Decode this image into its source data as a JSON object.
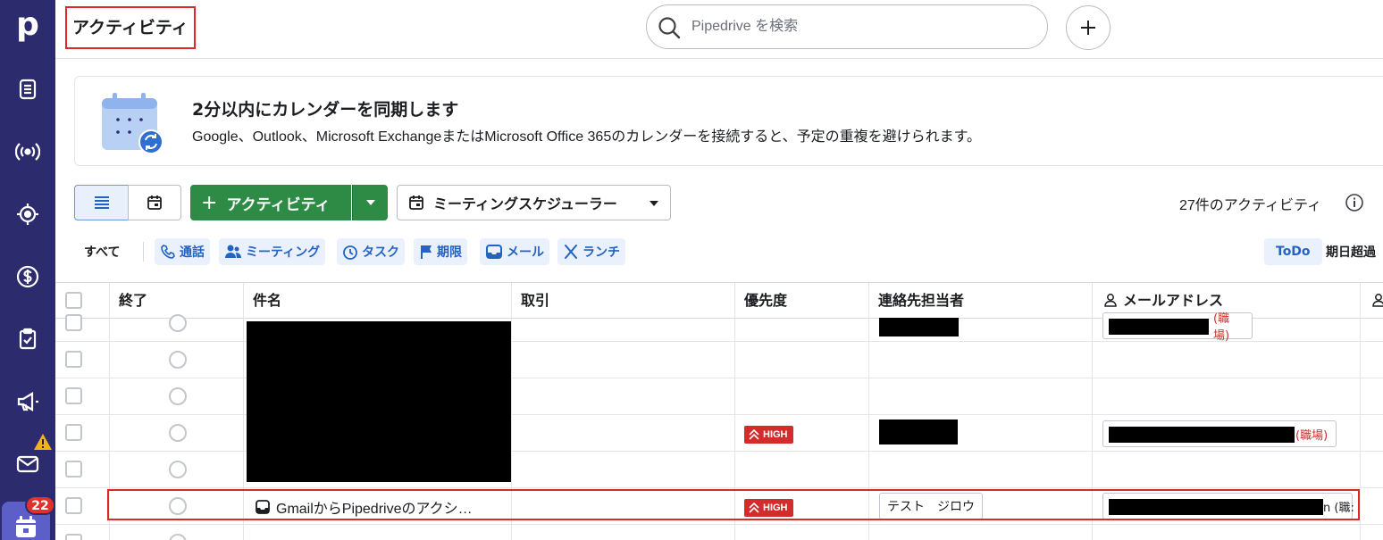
{
  "app": {
    "logo_letter": "p",
    "page_title": "アクティビティ",
    "activities_badge": "22"
  },
  "search": {
    "placeholder": "Pipedrive を検索"
  },
  "banner": {
    "title": "2分以内にカレンダーを同期します",
    "text": "Google、Outlook、Microsoft ExchangeまたはMicrosoft Office 365のカレンダーを接続すると、予定の重複を避けられます。"
  },
  "toolbar": {
    "add_label": "アクティビティ",
    "scheduler_label": "ミーティングスケジューラー",
    "count_text": "27件のアクティビティ"
  },
  "filters": {
    "all": "すべて",
    "types": [
      {
        "label": "通話",
        "icon": "phone-icon"
      },
      {
        "label": "ミーティング",
        "icon": "people-icon"
      },
      {
        "label": "タスク",
        "icon": "clock-icon"
      },
      {
        "label": "期限",
        "icon": "flag-icon"
      },
      {
        "label": "メール",
        "icon": "inbox-icon"
      },
      {
        "label": "ランチ",
        "icon": "utensils-icon"
      }
    ],
    "todo": "ToDo",
    "overdue": "期日超過"
  },
  "table": {
    "headers": {
      "done": "終了",
      "subject": "件名",
      "deal": "取引",
      "priority": "優先度",
      "contact": "連絡先担当者",
      "email": "メールアドレス"
    },
    "rows": [
      {
        "priority": "",
        "contact": "",
        "email_tag": "(職場)"
      },
      {
        "priority": "",
        "contact": "",
        "email_tag": ""
      },
      {
        "priority": "",
        "contact": "",
        "email_tag": ""
      },
      {
        "priority": "HIGH",
        "contact": "",
        "email_tag": "(職場)"
      },
      {
        "priority": "",
        "contact": "",
        "email_tag": ""
      },
      {
        "priority": "HIGH",
        "subject": "GmailからPipedriveのアクシ…",
        "contact": "テスト　ジロウ",
        "email_tag": "n (職:"
      }
    ]
  },
  "colors": {
    "rail": "#2c2b6e",
    "primary_green": "#2e8b46",
    "high_red": "#d32c2c",
    "chip_blue": "#2363c2"
  }
}
